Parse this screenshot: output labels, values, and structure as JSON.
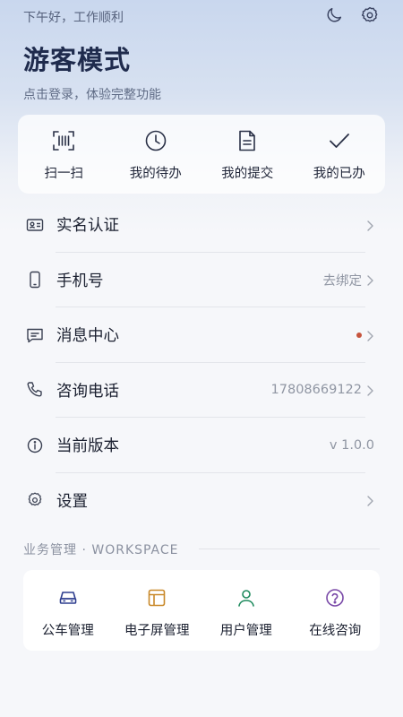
{
  "header": {
    "greeting": "下午好，工作顺利",
    "title": "游客模式",
    "subtitle": "点击登录，体验完整功能",
    "icons": [
      "moon-icon",
      "settings-icon"
    ]
  },
  "quick_actions": [
    {
      "label": "扫一扫",
      "icon": "scan-icon"
    },
    {
      "label": "我的待办",
      "icon": "clock-icon"
    },
    {
      "label": "我的提交",
      "icon": "document-icon"
    },
    {
      "label": "我的已办",
      "icon": "check-icon"
    }
  ],
  "menu": [
    {
      "label": "实名认证",
      "value": "",
      "icon": "id-card-icon",
      "chevron": true
    },
    {
      "label": "手机号",
      "value": "去绑定",
      "icon": "phone-icon",
      "chevron": true
    },
    {
      "label": "消息中心",
      "value": "",
      "icon": "message-icon",
      "chevron": true,
      "unread_dot": true
    },
    {
      "label": "咨询电话",
      "value": "17808669122",
      "icon": "telephone-icon",
      "chevron": true
    },
    {
      "label": "当前版本",
      "value": "v 1.0.0",
      "icon": "info-icon",
      "chevron": false
    },
    {
      "label": "设置",
      "value": "",
      "icon": "gear-icon",
      "chevron": true
    }
  ],
  "workspace": {
    "title": "业务管理 · WORKSPACE",
    "items": [
      {
        "label": "公车管理",
        "icon": "car-icon",
        "color": "#2f3f8f"
      },
      {
        "label": "电子屏管理",
        "icon": "screen-layout-icon",
        "color": "#c9892a"
      },
      {
        "label": "用户管理",
        "icon": "user-icon",
        "color": "#1d8a5d"
      },
      {
        "label": "在线咨询",
        "icon": "help-icon",
        "color": "#7a4aa8"
      }
    ]
  },
  "colors": {
    "accent_dot": "#c6543d",
    "hero_top": "#c9d7ee",
    "background": "#f6f7fa"
  }
}
